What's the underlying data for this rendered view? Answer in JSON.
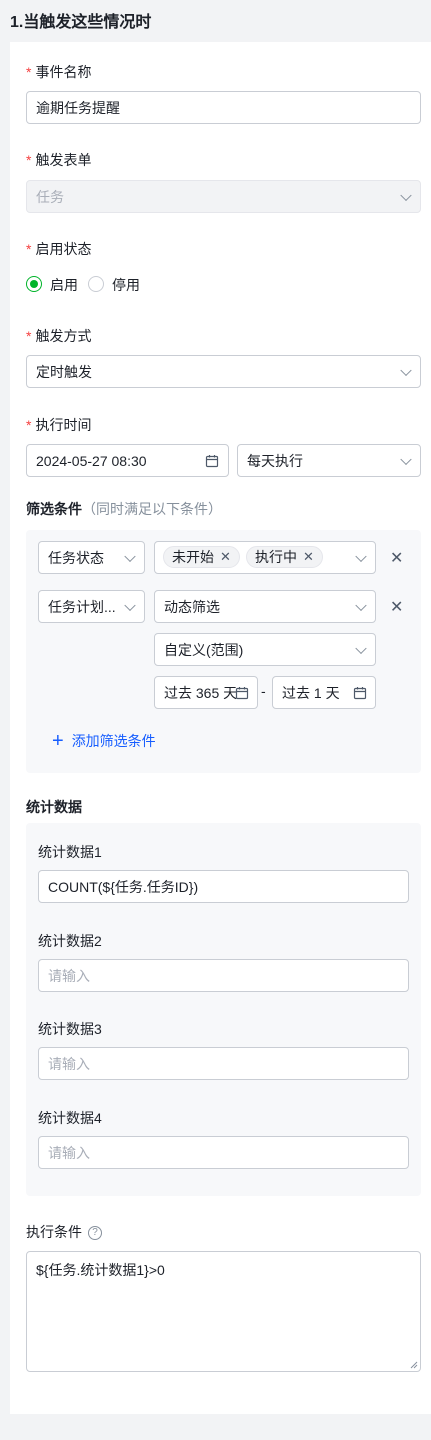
{
  "section_title": "1.当触发这些情况时",
  "required_mark": "*",
  "event_name": {
    "label": "事件名称",
    "value": "逾期任务提醒"
  },
  "trigger_form": {
    "label": "触发表单",
    "value": "任务"
  },
  "enable_status": {
    "label": "启用状态",
    "options": [
      "启用",
      "停用"
    ],
    "selected": "启用"
  },
  "trigger_mode": {
    "label": "触发方式",
    "value": "定时触发"
  },
  "exec_time": {
    "label": "执行时间",
    "datetime": "2024-05-27 08:30",
    "repeat": "每天执行"
  },
  "filter": {
    "title": "筛选条件",
    "hint": "（同时满足以下条件）",
    "row1": {
      "field": "任务状态",
      "tags": [
        "未开始",
        "执行中"
      ]
    },
    "row2": {
      "field": "任务计划...",
      "mode": "动态筛选",
      "range_type": "自定义(范围)",
      "from": "过去 365 天",
      "sep": "-",
      "to": "过去 1 天"
    },
    "add_label": "添加筛选条件",
    "add_icon": "plus-icon"
  },
  "stats": {
    "title": "统计数据",
    "items": [
      {
        "label": "统计数据1",
        "value": "COUNT(${任务.任务ID})",
        "placeholder": ""
      },
      {
        "label": "统计数据2",
        "value": "",
        "placeholder": "请输入"
      },
      {
        "label": "统计数据3",
        "value": "",
        "placeholder": "请输入"
      },
      {
        "label": "统计数据4",
        "value": "",
        "placeholder": "请输入"
      }
    ]
  },
  "exec_condition": {
    "label": "执行条件",
    "help_icon": "question-circle-icon",
    "value": "${任务.统计数据1}>0"
  },
  "colors": {
    "accent": "#165dff",
    "success": "#00b42a",
    "required": "#f53f3f"
  }
}
